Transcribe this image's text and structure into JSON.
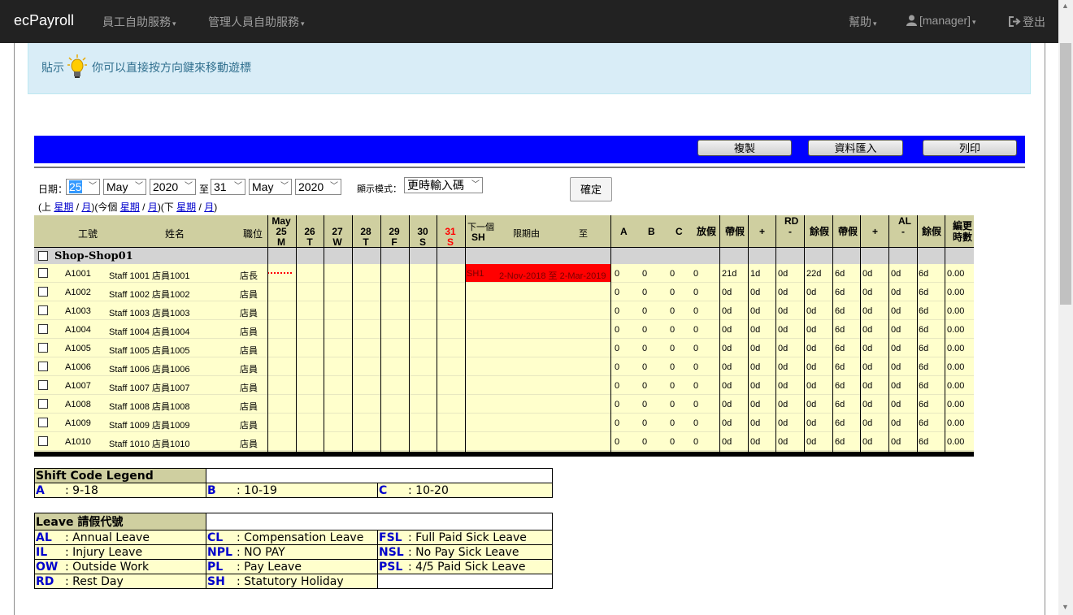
{
  "navbar": {
    "brand": "ecPayroll",
    "menu_employee": "員工自助服務",
    "menu_manager": "管理人員自助服務",
    "help": "幫助",
    "user": "[manager]",
    "logout": "登出"
  },
  "tip": {
    "label": "貼示",
    "text": "你可以直接按方向鍵來移動遊標"
  },
  "toolbar": {
    "copy": "複製",
    "import": "資料匯入",
    "print": "列印"
  },
  "filter": {
    "date_label": "日期：",
    "from_day": "25",
    "from_month": "May",
    "from_year": "2020",
    "to_label": "至",
    "to_day": "31",
    "to_month": "May",
    "to_year": "2020",
    "mode_label": "顯示模式：",
    "mode_value": "更時輸入碼",
    "confirm": "確定",
    "nav_prev": "(上",
    "nav_this": ")(今個",
    "nav_next": ")(下",
    "nav_end": ")",
    "week": "星期",
    "month": "月",
    "slash": "/"
  },
  "grid": {
    "col_id": "工號",
    "col_name": "姓名",
    "col_pos": "職位",
    "days": [
      {
        "top": "May",
        "d": "25",
        "w": "M",
        "red": false
      },
      {
        "top": "",
        "d": "26",
        "w": "T",
        "red": false
      },
      {
        "top": "",
        "d": "27",
        "w": "W",
        "red": false
      },
      {
        "top": "",
        "d": "28",
        "w": "T",
        "red": false
      },
      {
        "top": "",
        "d": "29",
        "w": "F",
        "red": false
      },
      {
        "top": "",
        "d": "30",
        "w": "S",
        "red": false
      },
      {
        "top": "",
        "d": "31",
        "w": "S",
        "red": true
      }
    ],
    "next_label": "下一個",
    "next_sh": "SH",
    "period_from": "限期由",
    "period_to": "至",
    "col_a": "A",
    "col_b": "B",
    "col_c": "C",
    "col_off": "放假",
    "rd_label": "RD",
    "al_label": "AL",
    "carry": "帶假",
    "plus": "+",
    "minus": "-",
    "balance": "餘假",
    "ot": "編更時數",
    "ot1": "編更",
    "ot2": "時數",
    "shop": "Shop-Shop01",
    "red_code": "SH1",
    "red_range": "2-Nov-2018 至 2-Mar-2019",
    "rows": [
      {
        "id": "A1001",
        "name": "Staff 1001 店員1001",
        "pos": "店長",
        "a": "0",
        "b": "0",
        "c": "0",
        "off": "0",
        "rd1": "21d",
        "rd2": "1d",
        "rd3": "0d",
        "rd4": "22d",
        "al1": "6d",
        "al2": "0d",
        "al3": "0d",
        "al4": "6d",
        "ot": "0.00"
      },
      {
        "id": "A1002",
        "name": "Staff 1002 店員1002",
        "pos": "店員",
        "a": "0",
        "b": "0",
        "c": "0",
        "off": "0",
        "rd1": "0d",
        "rd2": "0d",
        "rd3": "0d",
        "rd4": "0d",
        "al1": "6d",
        "al2": "0d",
        "al3": "0d",
        "al4": "6d",
        "ot": "0.00"
      },
      {
        "id": "A1003",
        "name": "Staff 1003 店員1003",
        "pos": "店員",
        "a": "0",
        "b": "0",
        "c": "0",
        "off": "0",
        "rd1": "0d",
        "rd2": "0d",
        "rd3": "0d",
        "rd4": "0d",
        "al1": "6d",
        "al2": "0d",
        "al3": "0d",
        "al4": "6d",
        "ot": "0.00"
      },
      {
        "id": "A1004",
        "name": "Staff 1004 店員1004",
        "pos": "店員",
        "a": "0",
        "b": "0",
        "c": "0",
        "off": "0",
        "rd1": "0d",
        "rd2": "0d",
        "rd3": "0d",
        "rd4": "0d",
        "al1": "6d",
        "al2": "0d",
        "al3": "0d",
        "al4": "6d",
        "ot": "0.00"
      },
      {
        "id": "A1005",
        "name": "Staff 1005 店員1005",
        "pos": "店員",
        "a": "0",
        "b": "0",
        "c": "0",
        "off": "0",
        "rd1": "0d",
        "rd2": "0d",
        "rd3": "0d",
        "rd4": "0d",
        "al1": "6d",
        "al2": "0d",
        "al3": "0d",
        "al4": "6d",
        "ot": "0.00"
      },
      {
        "id": "A1006",
        "name": "Staff 1006 店員1006",
        "pos": "店員",
        "a": "0",
        "b": "0",
        "c": "0",
        "off": "0",
        "rd1": "0d",
        "rd2": "0d",
        "rd3": "0d",
        "rd4": "0d",
        "al1": "6d",
        "al2": "0d",
        "al3": "0d",
        "al4": "6d",
        "ot": "0.00"
      },
      {
        "id": "A1007",
        "name": "Staff 1007 店員1007",
        "pos": "店員",
        "a": "0",
        "b": "0",
        "c": "0",
        "off": "0",
        "rd1": "0d",
        "rd2": "0d",
        "rd3": "0d",
        "rd4": "0d",
        "al1": "6d",
        "al2": "0d",
        "al3": "0d",
        "al4": "6d",
        "ot": "0.00"
      },
      {
        "id": "A1008",
        "name": "Staff 1008 店員1008",
        "pos": "店員",
        "a": "0",
        "b": "0",
        "c": "0",
        "off": "0",
        "rd1": "0d",
        "rd2": "0d",
        "rd3": "0d",
        "rd4": "0d",
        "al1": "6d",
        "al2": "0d",
        "al3": "0d",
        "al4": "6d",
        "ot": "0.00"
      },
      {
        "id": "A1009",
        "name": "Staff 1009 店員1009",
        "pos": "店員",
        "a": "0",
        "b": "0",
        "c": "0",
        "off": "0",
        "rd1": "0d",
        "rd2": "0d",
        "rd3": "0d",
        "rd4": "0d",
        "al1": "6d",
        "al2": "0d",
        "al3": "0d",
        "al4": "6d",
        "ot": "0.00"
      },
      {
        "id": "A1010",
        "name": "Staff 1010 店員1010",
        "pos": "店員",
        "a": "0",
        "b": "0",
        "c": "0",
        "off": "0",
        "rd1": "0d",
        "rd2": "0d",
        "rd3": "0d",
        "rd4": "0d",
        "al1": "6d",
        "al2": "0d",
        "al3": "0d",
        "al4": "6d",
        "ot": "0.00"
      }
    ]
  },
  "legend_shift": {
    "title": "Shift Code Legend",
    "items": [
      {
        "code": "A",
        "desc": ": 9-18"
      },
      {
        "code": "B",
        "desc": ": 10-19"
      },
      {
        "code": "C",
        "desc": ": 10-20"
      }
    ]
  },
  "legend_leave": {
    "title": "Leave 請假代號",
    "items": [
      {
        "code": "AL",
        "desc": ": Annual Leave"
      },
      {
        "code": "CL",
        "desc": ": Compensation Leave"
      },
      {
        "code": "FSL",
        "desc": ": Full Paid Sick Leave"
      },
      {
        "code": "IL",
        "desc": ": Injury Leave"
      },
      {
        "code": "NPL",
        "desc": ": NO PAY"
      },
      {
        "code": "NSL",
        "desc": ": No Pay Sick Leave"
      },
      {
        "code": "OW",
        "desc": ": Outside Work"
      },
      {
        "code": "PL",
        "desc": ": Pay Leave"
      },
      {
        "code": "PSL",
        "desc": ": 4/5 Paid Sick Leave"
      },
      {
        "code": "RD",
        "desc": ": Rest Day"
      },
      {
        "code": "SH",
        "desc": ": Statutory Holiday"
      }
    ]
  },
  "colors": {
    "navbar": "#222222",
    "bluebar": "#0000ff",
    "grid_bg": "#ffffcc",
    "header_bg": "#cfcfa0",
    "holiday": "#ff0000",
    "link": "#0000cc"
  }
}
